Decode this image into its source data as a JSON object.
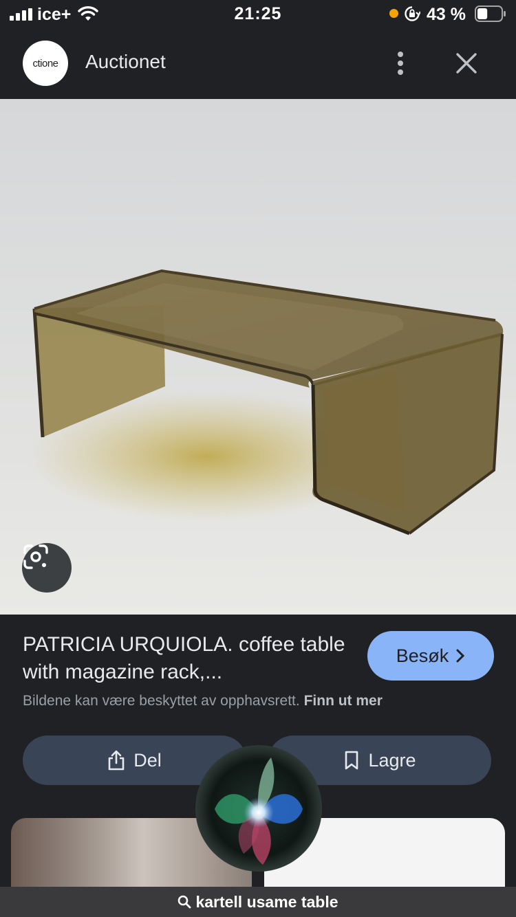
{
  "status_bar": {
    "carrier": "ice+",
    "time": "21:25",
    "battery_percent": "43 %",
    "battery_level": 0.43,
    "orange_dot_color": "#f4a40b"
  },
  "header": {
    "logo_text": "ctione",
    "site_name": "Auctionet",
    "more_icon": "more-vert-icon",
    "close_icon": "close-icon"
  },
  "image": {
    "description_icon": "lens-icon"
  },
  "result": {
    "title": "PATRICIA URQUIOLA. coffee table with magazine rack,...",
    "visit_label": "Besøk",
    "copyright_text": "Bildene kan være beskyttet av opphavsrett.",
    "learn_more": "Finn ut mer",
    "share_label": "Del",
    "save_label": "Lagre",
    "accent_color": "#8ab4f8"
  },
  "search": {
    "query": "kartell usame table"
  }
}
